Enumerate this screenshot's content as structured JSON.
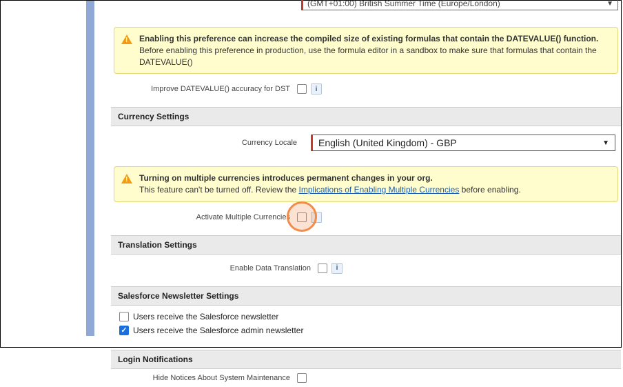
{
  "timezone": {
    "value": "(GMT+01:00) British Summer Time (Europe/London)"
  },
  "warn_datevalue": {
    "bold": "Enabling this preference can increase the compiled size of existing formulas that contain the DATEVALUE() function.",
    "rest": "Before enabling this preference in production, use the formula editor in a sandbox to make sure that formulas that contain the DATEVALUE()"
  },
  "field_dst": {
    "label": "Improve DATEVALUE() accuracy for DST"
  },
  "section_currency": "Currency Settings",
  "currency_locale": {
    "label": "Currency Locale",
    "value": "English (United Kingdom) - GBP"
  },
  "warn_multi": {
    "bold": "Turning on multiple currencies introduces permanent changes in your org.",
    "pre": "This feature can't be turned off. Review the ",
    "link": "Implications of Enabling Multiple Currencies",
    "post": " before enabling."
  },
  "field_multi": {
    "label": "Activate Multiple Currencies"
  },
  "section_translation": "Translation Settings",
  "field_translation": {
    "label": "Enable Data Translation"
  },
  "section_newsletter": "Salesforce Newsletter Settings",
  "newsletter": {
    "opt1": "Users receive the Salesforce newsletter",
    "opt2": "Users receive the Salesforce admin newsletter"
  },
  "section_login": "Login Notifications",
  "field_login": {
    "label": "Hide Notices About System Maintenance"
  }
}
